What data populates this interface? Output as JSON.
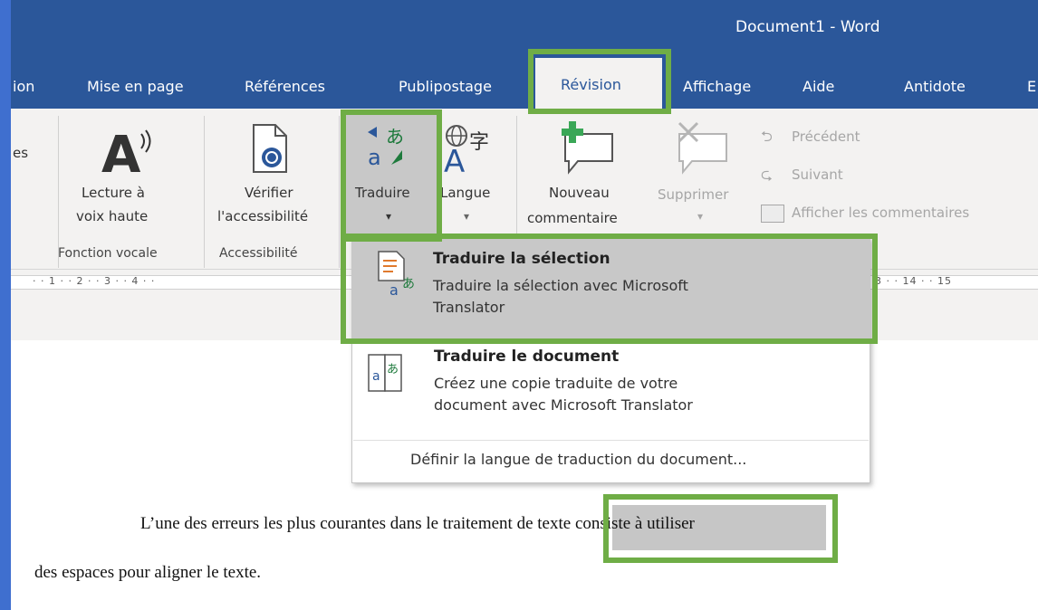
{
  "window": {
    "title": "Document1  -  Word"
  },
  "tabs": [
    "ion",
    "Mise en page",
    "Références",
    "Publipostage",
    "Révision",
    "Affichage",
    "Aide",
    "Antidote",
    "E"
  ],
  "ribbon": {
    "partial_label": "es",
    "lecture": {
      "line1": "Lecture à",
      "line2": "voix haute"
    },
    "verifier": {
      "line1": "Vérifier",
      "line2": "l'accessibilité"
    },
    "traduire": {
      "label": "Traduire",
      "arrow": "▾"
    },
    "langue": {
      "label": "Langue",
      "arrow": "▾"
    },
    "nouveau": {
      "line1": "Nouveau",
      "line2": "commentaire"
    },
    "supprimer": {
      "label": "Supprimer",
      "arrow": "▾"
    },
    "precedent": "Précédent",
    "suivant": "Suivant",
    "afficher": "Afficher les commentaires",
    "groups": {
      "fonction_vocale": "Fonction vocale",
      "accessibilite": "Accessibilité"
    }
  },
  "ruler": {
    "left": "· · 1 · · 2 · · 3 · · 4 · ·",
    "right": "3 · · 14 · · 15"
  },
  "menu": {
    "item1": {
      "title": "Traduire la sélection",
      "desc1": "Traduire la sélection avec Microsoft",
      "desc2": "Translator"
    },
    "item2": {
      "title": "Traduire le document",
      "desc1": "Créez une copie traduite de votre",
      "desc2": "document avec Microsoft Translator"
    },
    "item3": "Définir la langue de traduction du document..."
  },
  "document": {
    "line1_before": "L’une des erreurs les plus courantes dans le ",
    "line1_highlight": "traitement de texte",
    "line1_after": " consiste à utiliser",
    "line2": "des espaces pour aligner le texte."
  },
  "colors": {
    "title_bar": "#2b579a",
    "ribbon": "#f3f2f1",
    "callout": "#6fad46",
    "selection": "#c6c6c6"
  }
}
